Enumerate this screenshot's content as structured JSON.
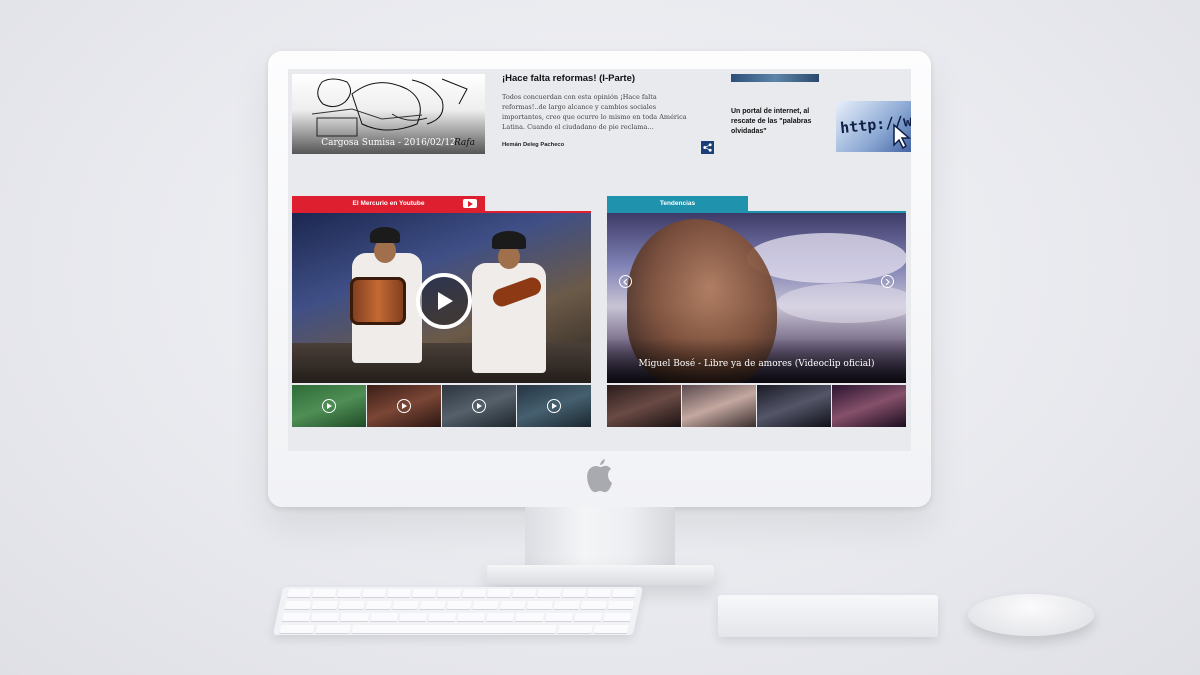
{
  "news": {
    "cartoon_caption": "Cargosa Sumisa - 2016/02/12",
    "cartoon_signature": "Rafa",
    "article_title": "¡Hace falta reformas! (I-Parte)",
    "article_body": "Todos concuerdan con esta opinión ¡Hace falta reformas!..de largo alcance y cambios sociales importantes, creo que ocurre lo mismo en toda América Latina. Cuando el ciudadano de pie reclama…",
    "article_author": "Hemán Deleg Pacheco",
    "portal_title": "Un portal de internet, al rescate de las \"palabras olvidadas\"",
    "portal_image_text": "http://ww"
  },
  "youtube_section": {
    "tab_label": "El Mercurio en Youtube",
    "accent": "#dd1f2f"
  },
  "trends_section": {
    "tab_label": "Tendencias",
    "video_caption": "Miguel Bosé - Libre ya de amores (Videoclip oficial)",
    "accent": "#1f93ad"
  },
  "icons": {
    "play": "play-icon",
    "share": "share-icon",
    "youtube": "youtube-icon",
    "arrow_left": "arrow-left-icon",
    "arrow_right": "arrow-right-icon",
    "apple": "apple-logo-icon"
  }
}
